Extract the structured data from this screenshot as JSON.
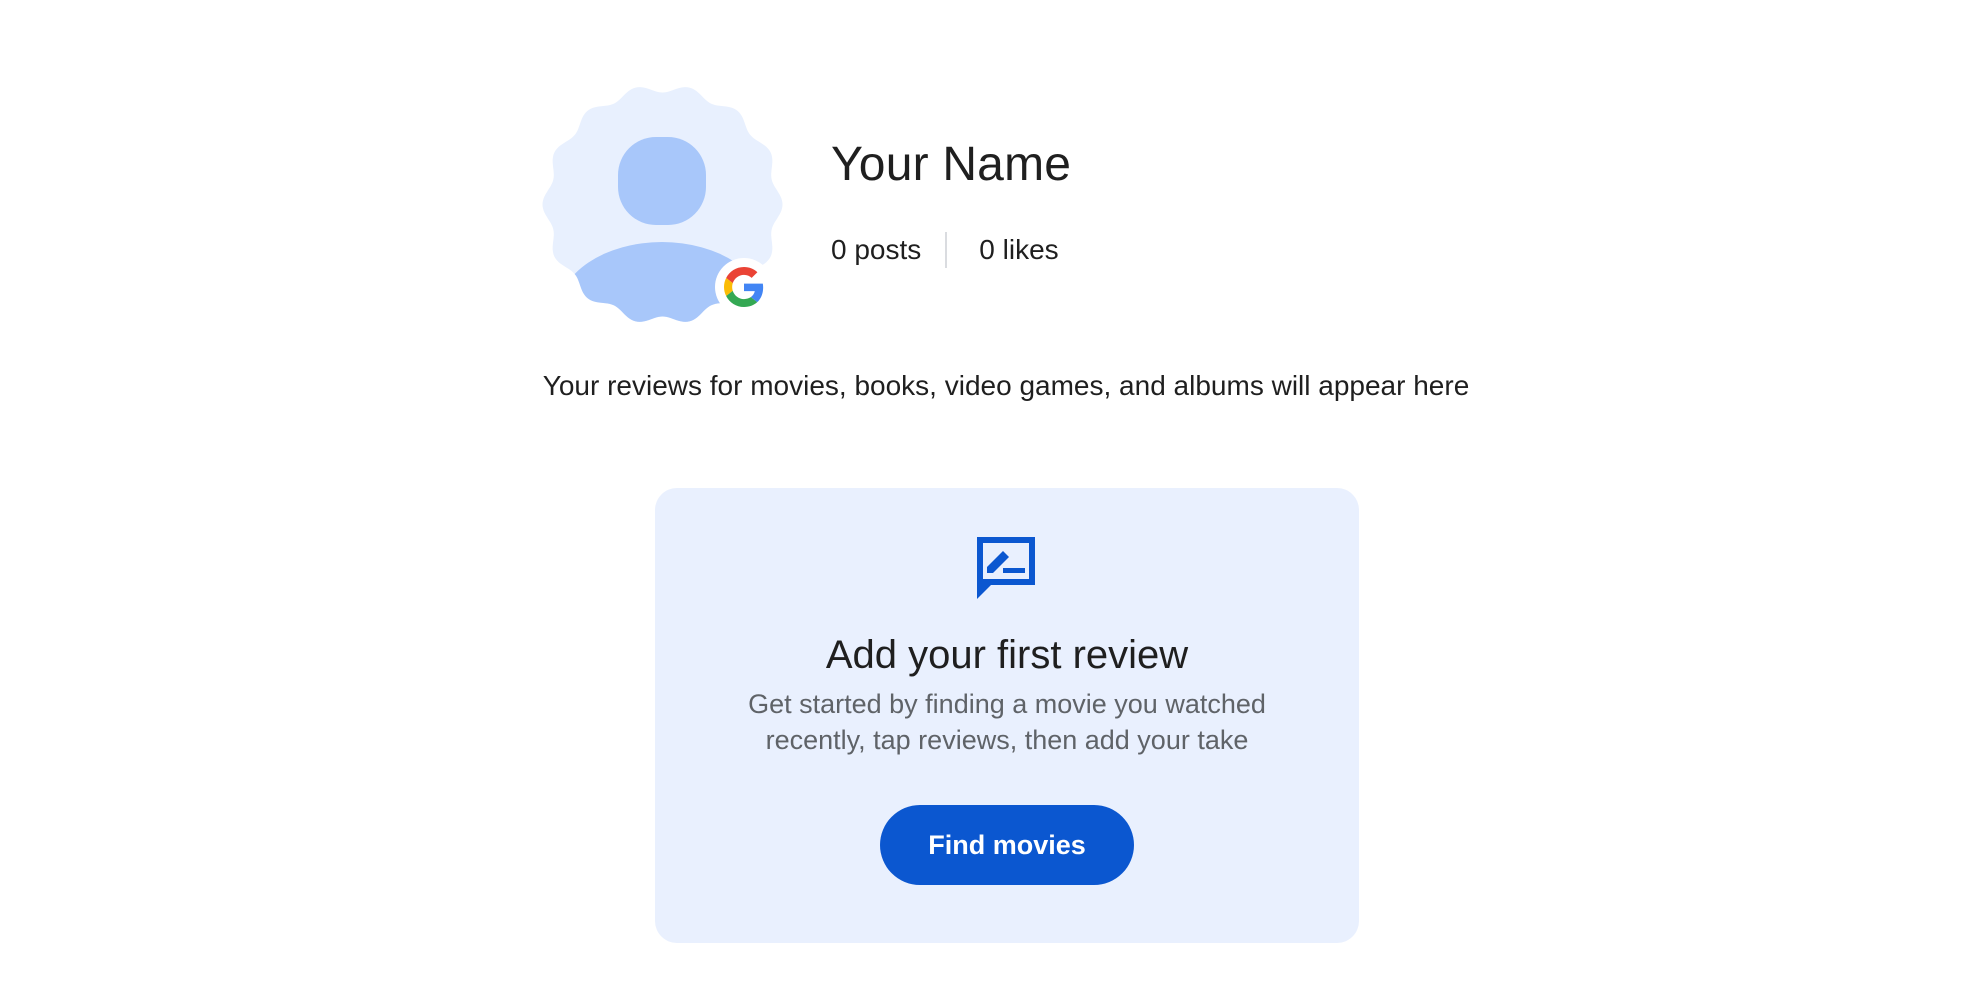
{
  "profile": {
    "name": "Your Name",
    "posts": "0 posts",
    "likes": "0 likes"
  },
  "subtitle": "Your reviews for movies, books, video games, and albums will appear here",
  "empty_card": {
    "icon": "rate-review-icon",
    "title": "Add your first review",
    "description": "Get started by finding a movie you watched recently, tap reviews, then add your take",
    "button_label": "Find movies"
  },
  "icons": {
    "avatar": "person-placeholder-icon",
    "badge": "google-g-icon"
  },
  "colors": {
    "avatar_bg": "#e8f0fe",
    "avatar_figure": "#a8c7fa",
    "card_bg": "#e9f0fe",
    "accent": "#0b57d0",
    "secondary_text": "#5f6368"
  }
}
